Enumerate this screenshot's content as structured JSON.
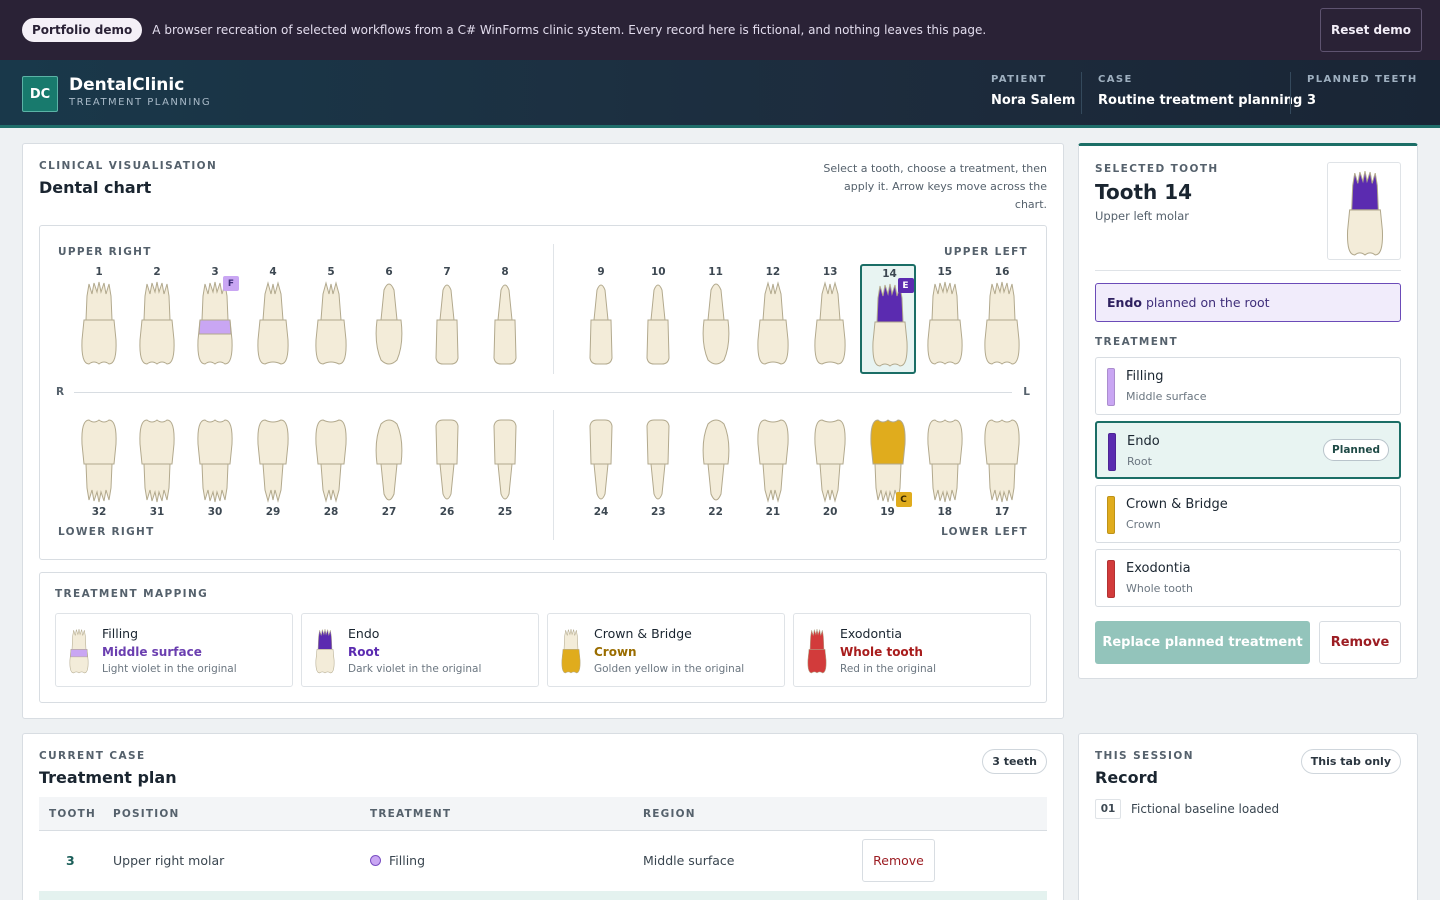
{
  "banner": {
    "pill": "Portfolio demo",
    "text": "A browser recreation of selected workflows from a C# WinForms clinic system. Every record here is fictional, and nothing leaves this page.",
    "reset": "Reset demo"
  },
  "app": {
    "logo": "DC",
    "name": "DentalClinic",
    "subtitle": "TREATMENT PLANNING",
    "patient_label": "PATIENT",
    "patient": "Nora Salem",
    "case_label": "CASE",
    "case": "Routine treatment planning",
    "planned_label": "PLANNED TEETH",
    "planned": "3"
  },
  "chart": {
    "eyebrow": "CLINICAL VISUALISATION",
    "title": "Dental chart",
    "help": "Select a tooth, choose a treatment, then apply it. Arrow keys move across the chart.",
    "upper_right": "UPPER RIGHT",
    "upper_left": "UPPER LEFT",
    "lower_right": "LOWER RIGHT",
    "lower_left": "LOWER LEFT",
    "r": "R",
    "l": "L",
    "upper_teeth": [
      "1",
      "2",
      "3",
      "4",
      "5",
      "6",
      "7",
      "8",
      "9",
      "10",
      "11",
      "12",
      "13",
      "14",
      "15",
      "16"
    ],
    "lower_teeth": [
      "32",
      "31",
      "30",
      "29",
      "28",
      "27",
      "26",
      "25",
      "24",
      "23",
      "22",
      "21",
      "20",
      "19",
      "18",
      "17"
    ],
    "badges": {
      "3": "F",
      "14": "E",
      "19": "C"
    },
    "selected": "14"
  },
  "mapping": {
    "eyebrow": "TREATMENT MAPPING",
    "items": [
      {
        "name": "Filling",
        "region": "Middle surface",
        "original": "Light violet in the original",
        "color": "#c9a6f3",
        "text_color": "#6b3fb0"
      },
      {
        "name": "Endo",
        "region": "Root",
        "original": "Dark violet in the original",
        "color": "#5b2bb0",
        "text_color": "#5b2bb0"
      },
      {
        "name": "Crown & Bridge",
        "region": "Crown",
        "original": "Golden yellow in the original",
        "color": "#e0ac1d",
        "text_color": "#9a6d00"
      },
      {
        "name": "Exodontia",
        "region": "Whole tooth",
        "original": "Red in the original",
        "color": "#d23b3b",
        "text_color": "#a81c1c"
      }
    ]
  },
  "selected_tooth": {
    "eyebrow": "SELECTED TOOTH",
    "title": "Tooth 14",
    "desc": "Upper left molar",
    "note_bold": "Endo",
    "note_rest": " planned on the root",
    "treatment_label": "TREATMENT",
    "options": [
      {
        "name": "Filling",
        "region": "Middle surface",
        "color": "#c9a6f3"
      },
      {
        "name": "Endo",
        "region": "Root",
        "color": "#5b2bb0",
        "tag": "Planned"
      },
      {
        "name": "Crown & Bridge",
        "region": "Crown",
        "color": "#e0ac1d"
      },
      {
        "name": "Exodontia",
        "region": "Whole tooth",
        "color": "#d23b3b"
      }
    ],
    "replace": "Replace planned treatment",
    "remove": "Remove"
  },
  "plan": {
    "eyebrow": "CURRENT CASE",
    "title": "Treatment plan",
    "count": "3 teeth",
    "headers": [
      "TOOTH",
      "POSITION",
      "TREATMENT",
      "REGION"
    ],
    "rows": [
      {
        "tooth": "3",
        "position": "Upper right molar",
        "treatment": "Filling",
        "region": "Middle surface",
        "remove": "Remove"
      }
    ]
  },
  "record": {
    "eyebrow": "THIS SESSION",
    "title": "Record",
    "scope": "This tab only",
    "entries": [
      {
        "num": "01",
        "text": "Fictional baseline loaded"
      }
    ]
  }
}
